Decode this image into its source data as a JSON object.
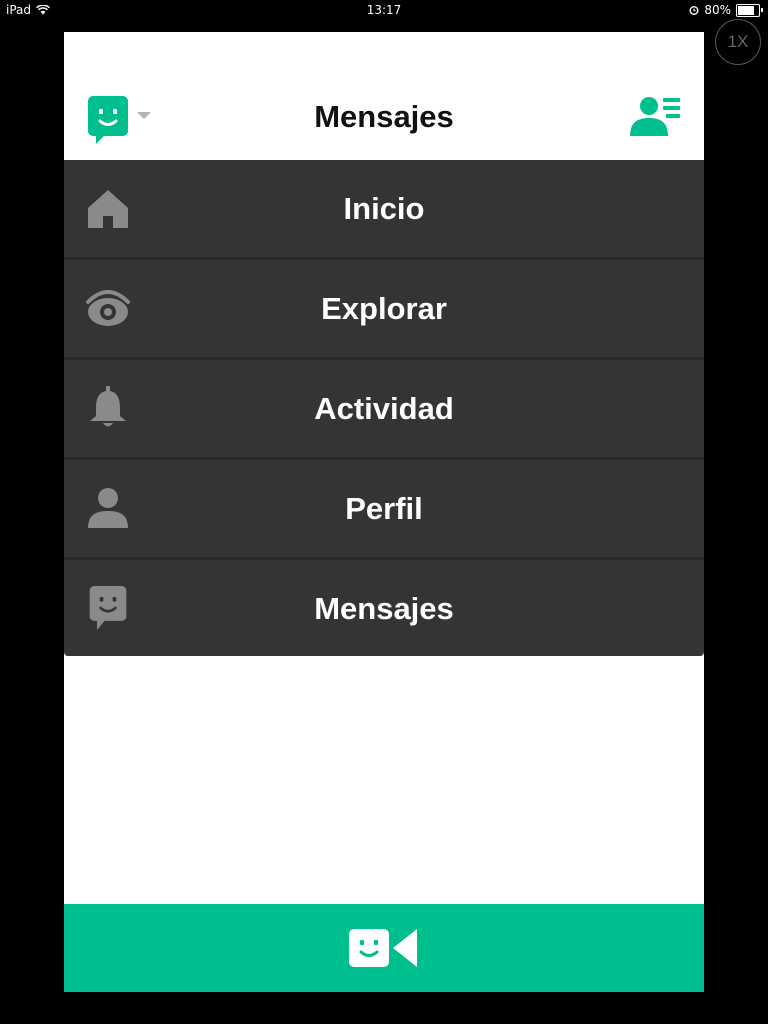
{
  "status_bar": {
    "device": "iPad",
    "time": "13:17",
    "battery_text": "80%",
    "battery_level": 0.8
  },
  "zoom_badge": "1X",
  "header": {
    "title": "Mensajes",
    "logo_icon": "smiley-speech-bubble-icon",
    "contacts_icon": "contacts-list-icon"
  },
  "menu": {
    "items": [
      {
        "label": "Inicio",
        "icon": "home-icon"
      },
      {
        "label": "Explorar",
        "icon": "eye-icon"
      },
      {
        "label": "Actividad",
        "icon": "bell-icon"
      },
      {
        "label": "Perfil",
        "icon": "person-icon"
      },
      {
        "label": "Mensajes",
        "icon": "smiley-speech-bubble-icon"
      }
    ]
  },
  "bottom_bar": {
    "icon": "video-camera-smiley-icon"
  },
  "colors": {
    "brand_green": "#00bf8f",
    "menu_bg": "#343434",
    "menu_icon": "#8a8a8a"
  }
}
